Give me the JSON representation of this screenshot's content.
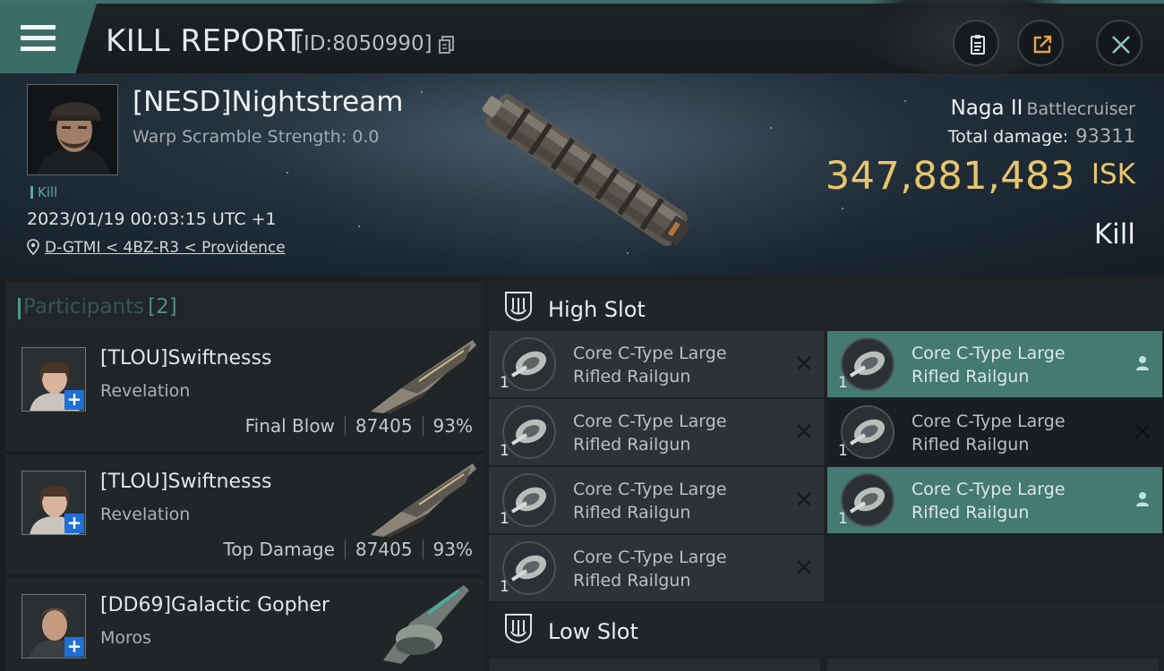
{
  "header": {
    "title": "KILL REPORT",
    "id_text": "[ID:8050990]",
    "menu_icon": "hamburger-icon",
    "buttons": [
      {
        "name": "clipboard",
        "icon": "clipboard-icon"
      },
      {
        "name": "share",
        "icon": "share-icon"
      },
      {
        "name": "close",
        "icon": "close-icon"
      }
    ]
  },
  "victim": {
    "name": "[NESD]Nightstream",
    "warp_scramble": "Warp Scramble Strength: 0.0",
    "tag": "Kill",
    "datetime": "2023/01/19 00:03:15 UTC +1",
    "location": "D-GTMI < 4BZ-R3 < Providence",
    "ship_name": "Naga II",
    "ship_class": "Battlecruiser",
    "total_damage_label": "Total damage:",
    "total_damage": "93311",
    "isk_value": "347,881,483",
    "isk_unit": "ISK",
    "result": "Kill"
  },
  "participants": {
    "label": "Participants",
    "count": "[2]",
    "rows": [
      {
        "name": "[TLOU]Swiftnesss",
        "ship": "Revelation",
        "role": "Final Blow",
        "damage": "87405",
        "percent": "93%"
      },
      {
        "name": "[TLOU]Swiftnesss",
        "ship": "Revelation",
        "role": "Top Damage",
        "damage": "87405",
        "percent": "93%"
      },
      {
        "name": "[DD69]Galactic Gopher",
        "ship": "Moros",
        "role": "",
        "damage": "",
        "percent": ""
      }
    ]
  },
  "fitting": {
    "high_slot_label": "High Slot",
    "low_slot_label": "Low Slot",
    "modules": [
      {
        "name_line1": "Core C-Type Large",
        "name_line2": "Rifled Railgun",
        "qty": "1",
        "state": "destroyed",
        "state_icon": "x-icon"
      },
      {
        "name_line1": "Core C-Type Large",
        "name_line2": "Rifled Railgun",
        "qty": "1",
        "state": "dropped",
        "state_icon": "person-icon"
      },
      {
        "name_line1": "Core C-Type Large",
        "name_line2": "Rifled Railgun",
        "qty": "1",
        "state": "destroyed",
        "state_icon": "x-icon"
      },
      {
        "name_line1": "Core C-Type Large",
        "name_line2": "Rifled Railgun",
        "qty": "1",
        "state": "destroyed",
        "state_icon": "x-icon"
      },
      {
        "name_line1": "Core C-Type Large",
        "name_line2": "Rifled Railgun",
        "qty": "1",
        "state": "destroyed",
        "state_icon": "x-icon"
      },
      {
        "name_line1": "Core C-Type Large",
        "name_line2": "Rifled Railgun",
        "qty": "1",
        "state": "dropped",
        "state_icon": "person-icon"
      },
      {
        "name_line1": "Core C-Type Large",
        "name_line2": "Rifled Railgun",
        "qty": "1",
        "state": "destroyed",
        "state_icon": "x-icon"
      }
    ]
  },
  "colors": {
    "accent": "#447a72",
    "isk": "#e8c56d",
    "plus_badge": "#1e6fd6"
  }
}
